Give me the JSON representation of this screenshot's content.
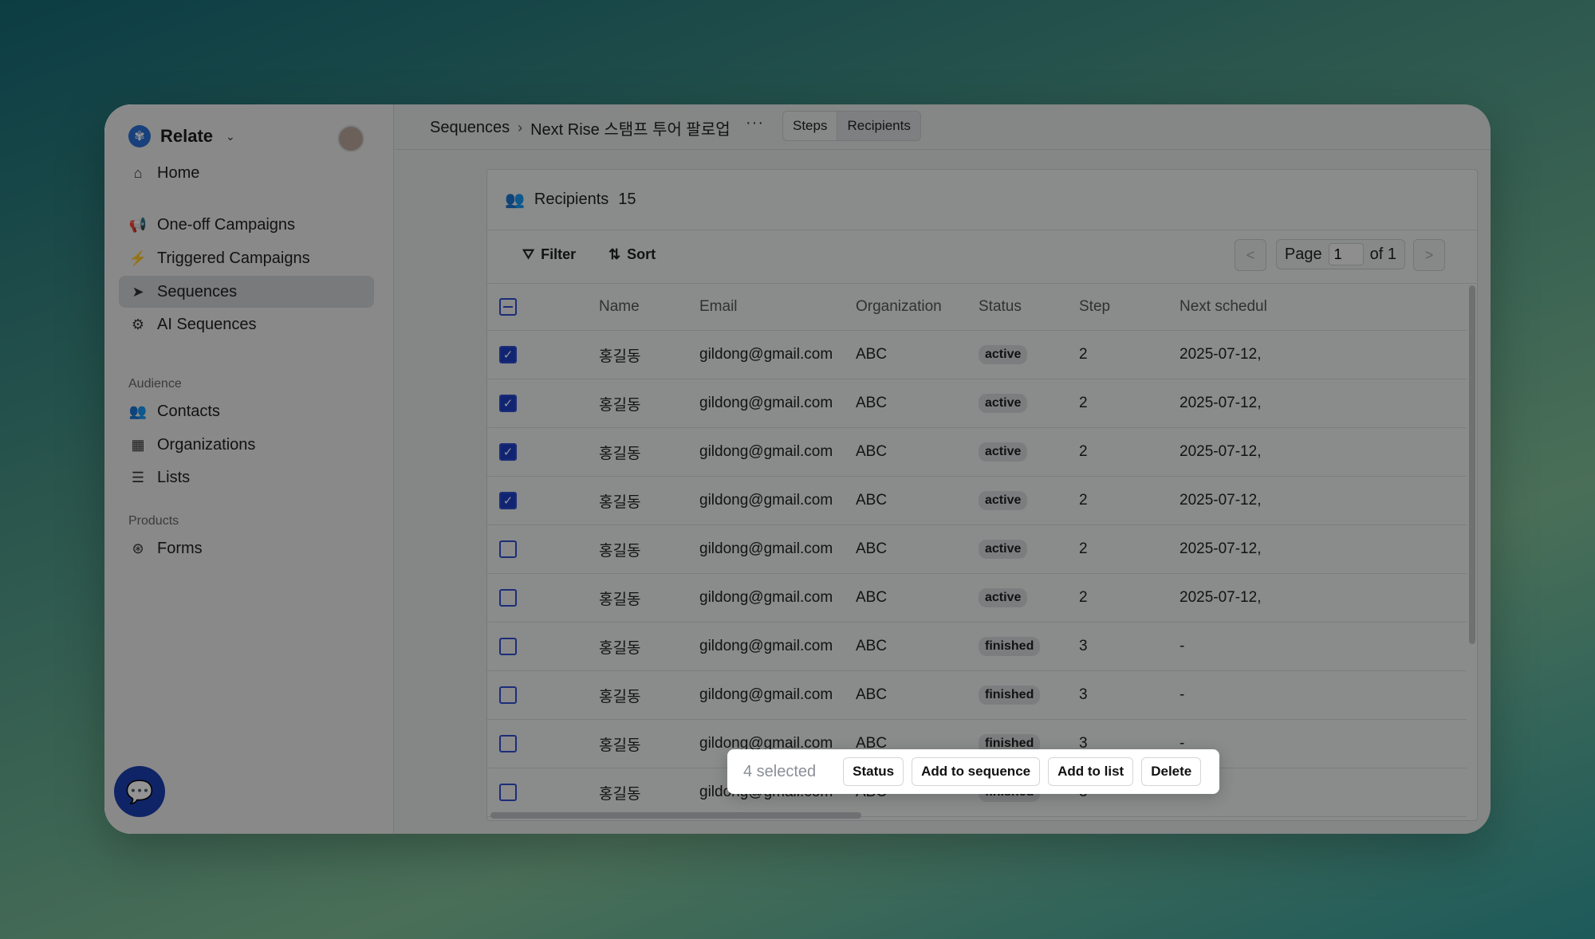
{
  "app": {
    "name": "Relate"
  },
  "sidebar": {
    "home": "Home",
    "items": [
      {
        "label": "One-off Campaigns",
        "icon": "megaphone-icon"
      },
      {
        "label": "Triggered Campaigns",
        "icon": "bolt-icon"
      },
      {
        "label": "Sequences",
        "icon": "send-icon",
        "active": true
      },
      {
        "label": "AI Sequences",
        "icon": "robot-icon"
      }
    ],
    "audience_label": "Audience",
    "audience": [
      {
        "label": "Contacts",
        "icon": "users-icon"
      },
      {
        "label": "Organizations",
        "icon": "building-icon"
      },
      {
        "label": "Lists",
        "icon": "list-icon"
      }
    ],
    "products_label": "Products",
    "products": [
      {
        "label": "Forms",
        "icon": "form-icon"
      }
    ]
  },
  "breadcrumb": {
    "root": "Sequences",
    "current": "Next Rise 스탬프 투어 팔로업",
    "more": "···"
  },
  "tabs": {
    "steps": "Steps",
    "recipients": "Recipients"
  },
  "panel": {
    "title": "Recipients",
    "count": "15"
  },
  "toolbar": {
    "filter": "Filter",
    "sort": "Sort"
  },
  "pager": {
    "prev": "<",
    "next": ">",
    "page_label": "Page",
    "page": "1",
    "of": "of 1"
  },
  "table": {
    "columns": [
      "Name",
      "Email",
      "Organization",
      "Status",
      "Step",
      "Next schedul"
    ],
    "rows": [
      {
        "checked": true,
        "name": "홍길동",
        "email": "gildong@gmail.com",
        "org": "ABC",
        "status": "active",
        "step": "2",
        "next": "2025-07-12,"
      },
      {
        "checked": true,
        "name": "홍길동",
        "email": "gildong@gmail.com",
        "org": "ABC",
        "status": "active",
        "step": "2",
        "next": "2025-07-12,"
      },
      {
        "checked": true,
        "name": "홍길동",
        "email": "gildong@gmail.com",
        "org": "ABC",
        "status": "active",
        "step": "2",
        "next": "2025-07-12,"
      },
      {
        "checked": true,
        "name": "홍길동",
        "email": "gildong@gmail.com",
        "org": "ABC",
        "status": "active",
        "step": "2",
        "next": "2025-07-12,"
      },
      {
        "checked": false,
        "name": "홍길동",
        "email": "gildong@gmail.com",
        "org": "ABC",
        "status": "active",
        "step": "2",
        "next": "2025-07-12,"
      },
      {
        "checked": false,
        "name": "홍길동",
        "email": "gildong@gmail.com",
        "org": "ABC",
        "status": "active",
        "step": "2",
        "next": "2025-07-12,"
      },
      {
        "checked": false,
        "name": "홍길동",
        "email": "gildong@gmail.com",
        "org": "ABC",
        "status": "finished",
        "step": "3",
        "next": "-"
      },
      {
        "checked": false,
        "name": "홍길동",
        "email": "gildong@gmail.com",
        "org": "ABC",
        "status": "finished",
        "step": "3",
        "next": "-"
      },
      {
        "checked": false,
        "name": "홍길동",
        "email": "gildong@gmail.com",
        "org": "ABC",
        "status": "finished",
        "step": "3",
        "next": "-"
      },
      {
        "checked": false,
        "name": "홍길동",
        "email": "gildong@gmail.com",
        "org": "ABC",
        "status": "finished",
        "step": "3",
        "next": "-"
      }
    ]
  },
  "selection": {
    "count_label": "4 selected",
    "actions": [
      "Status",
      "Add to sequence",
      "Add to list",
      "Delete"
    ]
  }
}
